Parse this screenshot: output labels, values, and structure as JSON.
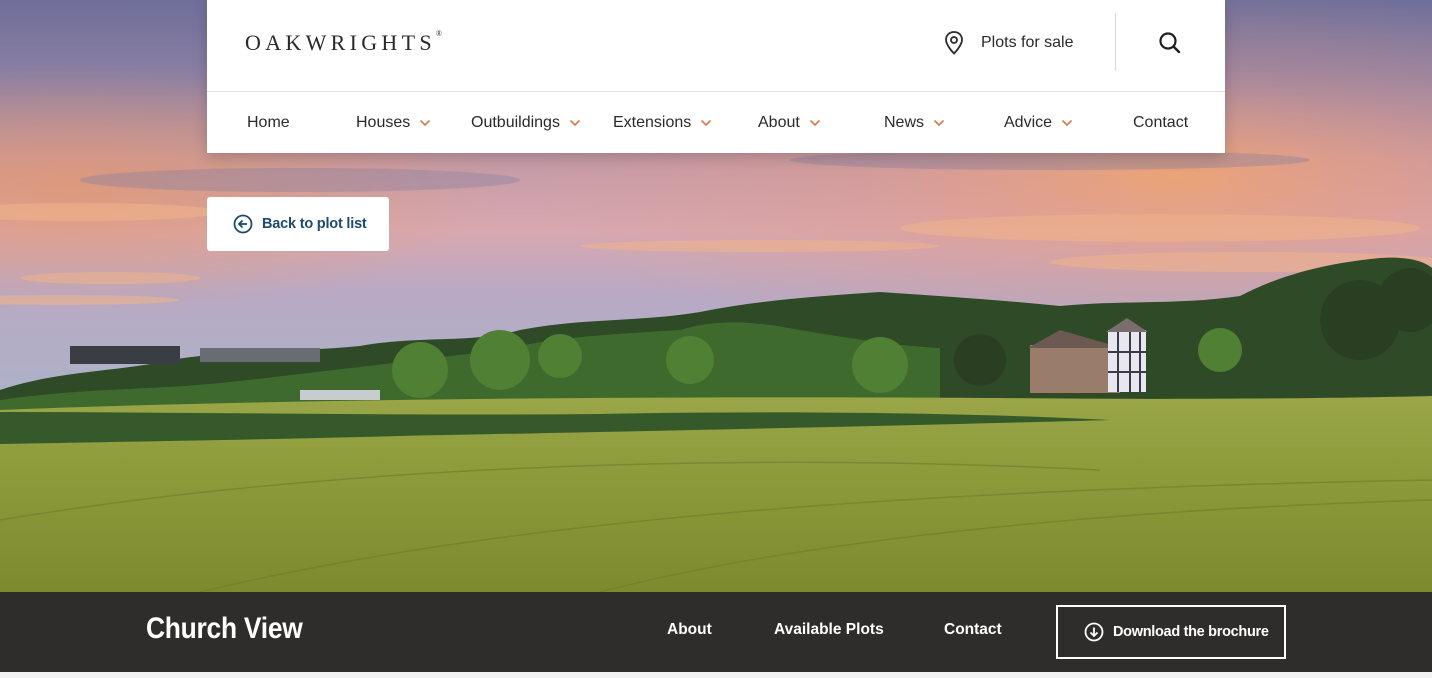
{
  "header": {
    "logo_text": "OAKWRIGHTS",
    "logo_mark": "®",
    "plots_link": {
      "label": "Plots for sale",
      "icon": "map-pin-icon"
    },
    "search": {
      "icon": "search-icon"
    },
    "nav": [
      {
        "label": "Home",
        "has_dropdown": false
      },
      {
        "label": "Houses",
        "has_dropdown": true
      },
      {
        "label": "Outbuildings",
        "has_dropdown": true
      },
      {
        "label": "Extensions",
        "has_dropdown": true
      },
      {
        "label": "About",
        "has_dropdown": true
      },
      {
        "label": "News",
        "has_dropdown": true
      },
      {
        "label": "Advice",
        "has_dropdown": true
      },
      {
        "label": "Contact",
        "has_dropdown": false
      }
    ]
  },
  "back_button": {
    "label": "Back to plot list",
    "icon": "arrow-left-circle-icon"
  },
  "development": {
    "title": "Church View",
    "links": [
      {
        "label": "About"
      },
      {
        "label": "Available Plots"
      },
      {
        "label": "Contact"
      }
    ],
    "brochure_button": {
      "label": "Download the brochure",
      "icon": "download-circle-icon"
    }
  },
  "colors": {
    "accent_chevron": "#d97a4a",
    "back_text": "#1d4a72",
    "bottom_bar": "#2e2d2b"
  }
}
